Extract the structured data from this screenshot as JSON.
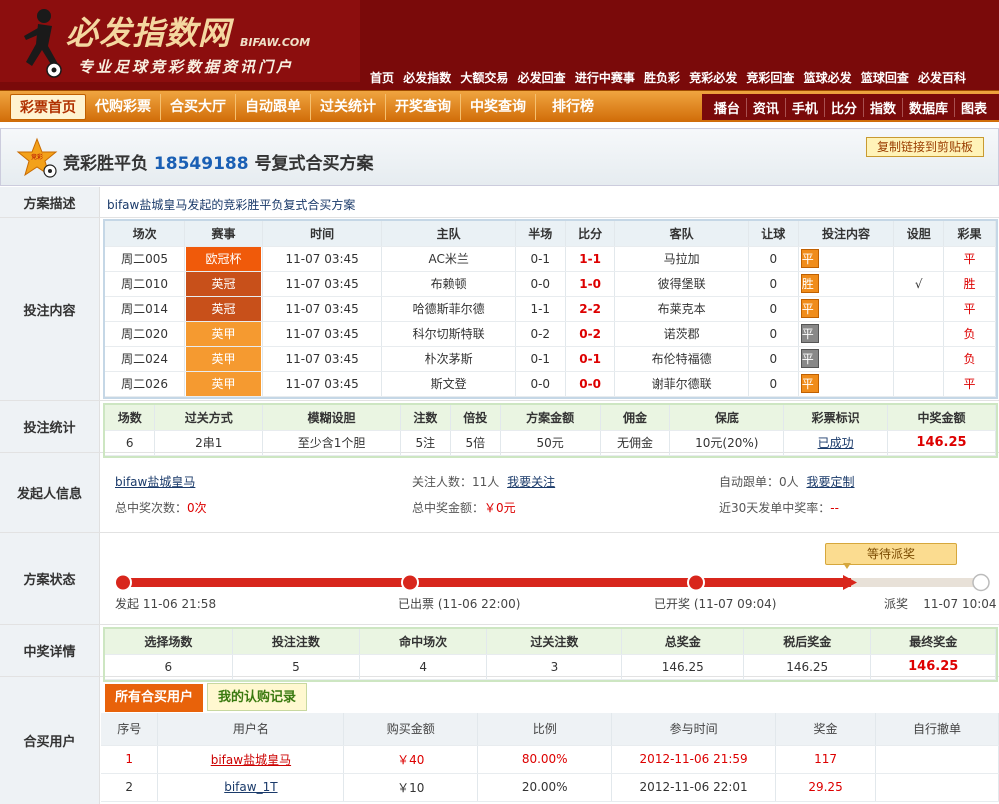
{
  "header": {
    "logo_title": "必发指数网",
    "logo_domain": "BIFAW.COM",
    "logo_slogan": "专业足球竞彩数据资讯门户",
    "topnav": [
      "首页",
      "必发指数",
      "大额交易",
      "必发回查",
      "进行中赛事",
      "胜负彩",
      "竞彩必发",
      "竞彩回查",
      "篮球必发",
      "篮球回查",
      "必发百科"
    ]
  },
  "mainnav": {
    "left": [
      "彩票首页",
      "代购彩票",
      "合买大厅",
      "自动跟单",
      "过关统计",
      "开奖查询",
      "中奖查询",
      "排行榜"
    ],
    "right": [
      "播台",
      "资讯",
      "手机",
      "比分",
      "指数",
      "数据库",
      "图表"
    ]
  },
  "titlebar": {
    "prefix": "竞彩胜平负",
    "number": "18549188",
    "suffix": "号复式合买方案",
    "copy_button": "复制链接到剪贴板",
    "icon_label": "竞彩"
  },
  "labels": {
    "desc": "方案描述",
    "bet_content": "投注内容",
    "bet_stats": "投注统计",
    "initiator": "发起人信息",
    "status": "方案状态",
    "prize_detail": "中奖详情",
    "buyers": "合买用户"
  },
  "description": "bifaw盐城皇马发起的竞彩胜平负复式合买方案",
  "matches": {
    "headers": [
      "场次",
      "赛事",
      "时间",
      "主队",
      "半场",
      "比分",
      "客队",
      "让球",
      "投注内容",
      "设胆",
      "彩果"
    ],
    "rows": [
      {
        "id": "周二005",
        "league": "欧冠杯",
        "league_color": "#f05a0a",
        "time": "11-07 03:45",
        "home": "AC米兰",
        "half": "0-1",
        "score": "1-1",
        "away": "马拉加",
        "handicap": "0",
        "pick": "平",
        "pick_style": "orange",
        "banker": "",
        "result": "平"
      },
      {
        "id": "周二010",
        "league": "英冠",
        "league_color": "#c8501a",
        "time": "11-07 03:45",
        "home": "布赖顿",
        "half": "0-0",
        "score": "1-0",
        "away": "彼得堡联",
        "handicap": "0",
        "pick": "胜",
        "pick_style": "orange",
        "banker": "√",
        "result": "胜"
      },
      {
        "id": "周二014",
        "league": "英冠",
        "league_color": "#c8501a",
        "time": "11-07 03:45",
        "home": "哈德斯菲尔德",
        "half": "1-1",
        "score": "2-2",
        "away": "布莱克本",
        "handicap": "0",
        "pick": "平",
        "pick_style": "orange",
        "banker": "",
        "result": "平"
      },
      {
        "id": "周二020",
        "league": "英甲",
        "league_color": "#f59a30",
        "time": "11-07 03:45",
        "home": "科尔切斯特联",
        "half": "0-2",
        "score": "0-2",
        "away": "诺茨郡",
        "handicap": "0",
        "pick": "平",
        "pick_style": "gray",
        "banker": "",
        "result": "负"
      },
      {
        "id": "周二024",
        "league": "英甲",
        "league_color": "#f59a30",
        "time": "11-07 03:45",
        "home": "朴次茅斯",
        "half": "0-1",
        "score": "0-1",
        "away": "布伦特福德",
        "handicap": "0",
        "pick": "平",
        "pick_style": "gray",
        "banker": "",
        "result": "负"
      },
      {
        "id": "周二026",
        "league": "英甲",
        "league_color": "#f59a30",
        "time": "11-07 03:45",
        "home": "斯文登",
        "half": "0-0",
        "score": "0-0",
        "away": "谢菲尔德联",
        "handicap": "0",
        "pick": "平",
        "pick_style": "orange",
        "banker": "",
        "result": "平"
      }
    ]
  },
  "stats": {
    "headers": [
      "场数",
      "过关方式",
      "模糊设胆",
      "注数",
      "倍投",
      "方案金额",
      "佣金",
      "保底",
      "彩票标识",
      "中奖金额"
    ],
    "values": [
      "6",
      "2串1",
      "至少含1个胆",
      "5注",
      "5倍",
      "50元",
      "无佣金",
      "10元(20%)",
      "已成功",
      "146.25"
    ]
  },
  "initiator": {
    "name": "bifaw盐城皇马",
    "follow_label": "关注人数：",
    "follow_count": "11人",
    "follow_link": "我要关注",
    "auto_label": "自动跟单：",
    "auto_count": "0人",
    "auto_link": "我要定制",
    "total_wins_label": "总中奖次数：",
    "total_wins": "0次",
    "total_amount_label": "总中奖金额：",
    "total_amount": "￥0元",
    "rate_label": "近30天发单中奖率：",
    "rate": "--"
  },
  "status": {
    "badge": "等待派奖",
    "steps": [
      {
        "label": "发起 11-06 21:58"
      },
      {
        "label": "已出票 (11-06 22:00)"
      },
      {
        "label": "已开奖 (11-07 09:04)"
      },
      {
        "label": "派奖    11-07 10:04"
      }
    ]
  },
  "prize": {
    "headers": [
      "选择场数",
      "投注注数",
      "命中场次",
      "过关注数",
      "总奖金",
      "税后奖金",
      "最终奖金"
    ],
    "values": [
      "6",
      "5",
      "4",
      "3",
      "146.25",
      "146.25",
      "146.25"
    ]
  },
  "buyers": {
    "tabs": [
      "所有合买用户",
      "我的认购记录"
    ],
    "headers": [
      "序号",
      "用户名",
      "购买金额",
      "比例",
      "参与时间",
      "奖金",
      "自行撤单"
    ],
    "rows": [
      {
        "no": "1",
        "user": "bifaw盐城皇马",
        "amount": "￥40",
        "ratio": "80.00%",
        "time": "2012-11-06 21:59",
        "prize": "117",
        "cancel": ""
      },
      {
        "no": "2",
        "user": "bifaw_1T",
        "amount": "￥10",
        "ratio": "20.00%",
        "time": "2012-11-06 22:01",
        "prize": "29.25",
        "cancel": ""
      }
    ]
  },
  "colors": {
    "header_bg": "#7a0a0a",
    "nav_orange": "#e8820a",
    "progress_red": "#d8261c",
    "highlight_red": "#dd0000"
  }
}
